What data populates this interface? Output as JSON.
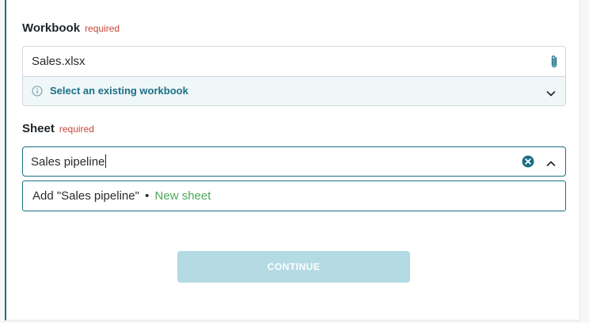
{
  "workbook": {
    "label": "Workbook",
    "required_text": "required",
    "value": "Sales.xlsx",
    "select_prompt": "Select an existing workbook"
  },
  "sheet": {
    "label": "Sheet",
    "required_text": "required",
    "value": "Sales pipeline"
  },
  "suggestion": {
    "add_text": "Add \"Sales pipeline\"",
    "bullet": "•",
    "tag": "New sheet"
  },
  "actions": {
    "continue_label": "CONTINUE"
  },
  "colors": {
    "accent": "#1d6f86",
    "required": "#c4463a",
    "new_sheet": "#4aa85a",
    "continue_disabled_bg": "#b4dbe4",
    "select_row_bg": "#eff7f9"
  },
  "icons": {
    "attachment": "paperclip-icon",
    "info": "info-icon",
    "dropdown": "chevron-down-icon",
    "clear": "clear-circle-icon",
    "collapse": "chevron-up-icon"
  }
}
